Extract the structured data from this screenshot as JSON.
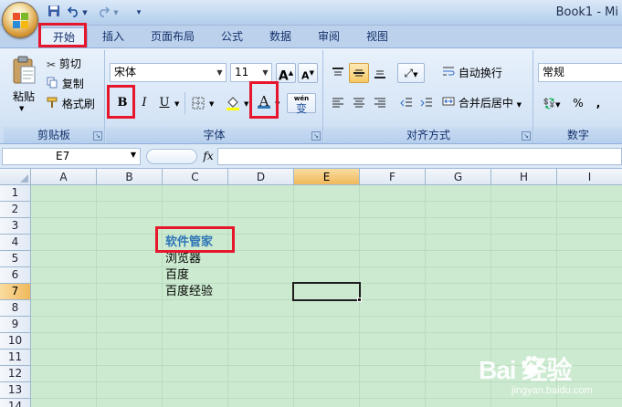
{
  "app": {
    "title": "Book1 - Mi"
  },
  "colors": {
    "highlight_box": "#e6162d",
    "selected_text": "#2e75b6",
    "sheet_bg": "#ccead0"
  },
  "quick_access": [
    {
      "icon": "save-icon"
    },
    {
      "icon": "undo-icon"
    },
    {
      "icon": "redo-icon"
    },
    {
      "icon": "customize-icon"
    }
  ],
  "tabs": [
    {
      "label": "开始",
      "active": true,
      "highlighted": true
    },
    {
      "label": "插入"
    },
    {
      "label": "页面布局"
    },
    {
      "label": "公式"
    },
    {
      "label": "数据"
    },
    {
      "label": "审阅"
    },
    {
      "label": "视图"
    }
  ],
  "ribbon": {
    "clipboard": {
      "label": "剪贴板",
      "paste": "粘贴",
      "cut": "剪切",
      "copy": "复制",
      "format_painter": "格式刷"
    },
    "font": {
      "label": "字体",
      "font_name": "宋体",
      "font_size": "11",
      "bold": "B",
      "italic": "I",
      "underline": "U",
      "font_color_letter": "A",
      "phonetic": "wén",
      "phonetic_char": "变",
      "grow_font": "A",
      "shrink_font": "A"
    },
    "alignment": {
      "label": "对齐方式",
      "wrap_text": "自动换行",
      "merge_center": "合并后居中"
    },
    "number": {
      "label": "数字",
      "format": "常规",
      "percent": "%",
      "comma": ","
    }
  },
  "formula_bar": {
    "name_box": "E7",
    "fx": "fx",
    "content": ""
  },
  "sheet": {
    "columns": [
      "A",
      "B",
      "C",
      "D",
      "E",
      "F",
      "G",
      "H",
      "I"
    ],
    "rows": [
      "1",
      "2",
      "3",
      "4",
      "5",
      "6",
      "7",
      "8",
      "9",
      "10",
      "11",
      "12",
      "13",
      "14"
    ],
    "selected_column": "E",
    "selected_row": "7",
    "cells": {
      "C4": "软件管家",
      "C5": "浏览器",
      "C6": "百度",
      "C7": "百度经验"
    }
  },
  "watermark": {
    "brand": "Bai  经验",
    "url": "jingyan.baidu.com"
  }
}
